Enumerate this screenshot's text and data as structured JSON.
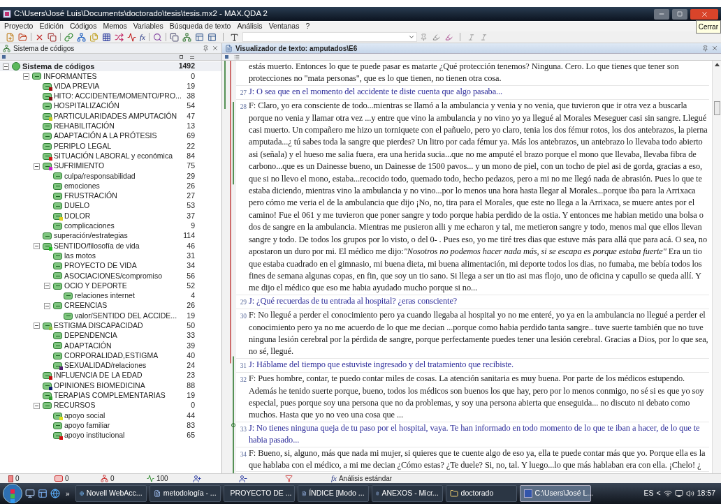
{
  "window": {
    "title": "C:\\Users\\José Luis\\Documents\\doctorado\\tesis\\tesis.mx2 - MAX.QDA 2",
    "tooltip": "Cerrar"
  },
  "menu": [
    "Proyecto",
    "Edición",
    "Códigos",
    "Memos",
    "Variables",
    "Búsqueda de texto",
    "Análisis",
    "Ventanas",
    "?"
  ],
  "toolbar": {
    "formula_symbol": "fx"
  },
  "code_system": {
    "title": "Sistema de códigos",
    "tree": [
      {
        "label": "Sistema de códigos",
        "count": "1492",
        "root": true,
        "expanded": true,
        "children": [
          {
            "label": "INFORMANTES",
            "count": "0",
            "expanded": true,
            "children": [
              {
                "label": "VIDA PREVIA",
                "count": "19",
                "color": "#a01010"
              },
              {
                "label": "HITO: ACCIDENTE/MOMENTO/PRO...",
                "count": "38",
                "color": "#801010"
              },
              {
                "label": "HOSPITALIZACIÓN",
                "count": "54"
              },
              {
                "label": "PARTICULARIDADES AMPUTACIÓN",
                "count": "47",
                "color": "#c8c820"
              },
              {
                "label": "REHABILITACIÓN",
                "count": "13"
              },
              {
                "label": "ADAPTACIÓN A LA PRÓTESIS",
                "count": "69"
              },
              {
                "label": "PERIPLO LEGAL",
                "count": "22"
              },
              {
                "label": "SITUACIÓN LABORAL y económica",
                "count": "84",
                "color": "#d01818"
              },
              {
                "label": "SUFRIMIENTO",
                "count": "75",
                "color": "#d020d0",
                "expanded": true,
                "children": [
                  {
                    "label": "culpa/responsabilidad",
                    "count": "29"
                  },
                  {
                    "label": "emociones",
                    "count": "26"
                  },
                  {
                    "label": "FRUSTRACIÓN",
                    "count": "27"
                  },
                  {
                    "label": "DUELO",
                    "count": "53"
                  },
                  {
                    "label": "DOLOR",
                    "count": "37",
                    "color": "#e0d020"
                  },
                  {
                    "label": "complicaciones",
                    "count": "9"
                  }
                ]
              },
              {
                "label": "superación/estrategias",
                "count": "114"
              },
              {
                "label": "SENTIDO/filosofía de vida",
                "count": "46",
                "color": "#20c020",
                "expanded": true,
                "children": [
                  {
                    "label": "las motos",
                    "count": "31"
                  },
                  {
                    "label": "PROYECTO DE VIDA",
                    "count": "34"
                  },
                  {
                    "label": "ASOCIACIONES/compromiso",
                    "count": "56"
                  },
                  {
                    "label": "OCIO Y DEPORTE",
                    "count": "52",
                    "expanded": true,
                    "children": [
                      {
                        "label": "relaciones internet",
                        "count": "4"
                      }
                    ]
                  },
                  {
                    "label": "CREENCIAS",
                    "count": "26",
                    "expanded": true,
                    "children": [
                      {
                        "label": "valor/SENTIDO DEL ACCIDE...",
                        "count": "19"
                      }
                    ]
                  }
                ]
              },
              {
                "label": "ESTIGMA DISCAPACIDAD",
                "count": "50",
                "color": "#90c040",
                "expanded": true,
                "children": [
                  {
                    "label": "DEPENDENCIA",
                    "count": "33"
                  },
                  {
                    "label": "ADAPTACIÓN",
                    "count": "39"
                  },
                  {
                    "label": "CORPORALIDAD,ESTIGMA",
                    "count": "40"
                  },
                  {
                    "label": "SEXUALIDAD/relaciones",
                    "count": "24",
                    "color": "#502070"
                  }
                ]
              },
              {
                "label": "INFLUENCIA DE LA EDAD",
                "count": "23",
                "color": "#c01010"
              },
              {
                "label": "OPINIONES BIOMEDICINA",
                "count": "88",
                "color": "#102070"
              },
              {
                "label": "TERAPIAS COMPLEMENTARIAS",
                "count": "19",
                "color": "#30a030"
              },
              {
                "label": "RECURSOS",
                "count": "0",
                "expanded": true,
                "children": [
                  {
                    "label": "apoyo social",
                    "count": "44",
                    "color": "#e0e020"
                  },
                  {
                    "label": "apoyo familiar",
                    "count": "83"
                  },
                  {
                    "label": "apoyo institucional",
                    "count": "65",
                    "color": "#d01010"
                  }
                ]
              }
            ]
          }
        ]
      }
    ]
  },
  "text_viewer": {
    "title": "Visualizador de texto: amputados\\E6",
    "paragraphs": [
      {
        "kind": "answer",
        "text": "estás muerto. Entonces lo que te puede pasar es matarte ¿Qué protección tenemos? Ninguna. Cero. Lo que tienes que tener son protecciones no \"mata personas\", que es lo que tienen, no tienen otra cosa."
      },
      {
        "kind": "question",
        "number": "27",
        "text": "J: O sea que en el momento del accidente te diste cuenta que algo pasaba..."
      },
      {
        "kind": "answer",
        "number": "28",
        "text": "F: Claro, yo era consciente de todo...mientras se llamó a la ambulancia y venia y no venia, que tuvieron que ir otra vez a buscarla porque no venia y llamar otra vez ...y entre que vino la ambulancia y no vino yo ya llegué al Morales Meseguer casi sin sangre. Llegué casi muerto. Un compañero me hizo un torniquete con el pañuelo, pero yo claro, tenia los dos fémur rotos, los dos antebrazos, la pierna amputada...¿ tú sabes toda la sangre que pierdes? Un litro por cada fémur ya. Más los antebrazos, un antebrazo lo llevaba todo abierto asi (señala) y el hueso me salia fuera, era una herida sucia...que no me amputé el brazo porque el mono que llevaba, llevaba fibra de carbono...que es un Dainesse bueno, un Dainesse de 1500 pavos... y un mono de piel, con un tocho de piel asi de gorda, gracias a eso, que si no llevo el mono, estaba...recocido todo, quemado todo, hecho pedazos, pero a mi no me llegó nada de abrasión. Pues lo que te estaba diciendo, mientras vino la ambulancia y no vino...por lo menos una hora hasta llegar al Morales...porque iba para la Arrixaca pero cómo me veria el de la ambulancia que dijo ¡No, no, tira para el Morales, que este no llega a la Arrixaca, se muere antes por el camino! Fue el 061 y me tuvieron que poner sangre y todo porque habia perdido de la ostia. Y entonces me habian metido una bolsa o dos de sangre en la ambulancia. Mientras me pusieron alli y me echaron y tal, me metieron sangre y todo, menos mal que ellos llevan sangre y todo. De todos los grupos por lo visto, o del  0- . Pues eso, yo me tiré tres dias que estuve más para allá que para acá. O sea, no apostaron un duro por mi. El médico me dijo:*\"Nosotros no podemos hacer nada más, si se escapa es porque estaba fuerte\"* Era un tio que estaba cuadrado en el gimnasio, mi buena dieta, mi buena alimentación,  mi deporte todos los dias, no fumaba, me bebía todos los fines de semana algunas copas, en fin, que soy un tio sano.  Si llega a ser un tio asi mas flojo, uno de oficina y capullo se queda allí. Y me dijo el médico que eso me habia ayudado mucho porque si no..."
      },
      {
        "kind": "question",
        "number": "29",
        "text": "J: ¿Qué recuerdas de tu entrada al hospital? ¿eras consciente?"
      },
      {
        "kind": "answer",
        "number": "30",
        "text": "F: No llegué a perder el conocimiento pero ya cuando llegaba al hospital yo no me enteré, yo ya en la ambulancia no llegué a perder el conocimiento pero ya no me acuerdo de lo que me decian ...porque como habia perdido tanta sangre.. tuve suerte también que no tuve ninguna lesión cerebral por la pérdida de sangre, porque perfectamente puedes tener una lesión cerebral. Gracias a Dios, por lo que sea, no sé, llegué."
      },
      {
        "kind": "question",
        "number": "31",
        "text": "J: Háblame del tiempo que estuviste ingresado y del tratamiento que recibiste."
      },
      {
        "kind": "answer",
        "number": "32",
        "text": "F: Pues hombre, contar, te puedo contar miles de cosas. La atención sanitaria es muy buena. Por parte de los médicos estupendo. Además he tenido suerte porque, bueno, todos los médicos son buenos los que hay, pero por lo menos conmigo, no sé si es que yo soy especial, pues porque soy una persona que  no da problemas, y soy una persona abierta que enseguida... no discuto ni debato como muchos. Hasta que yo no veo una cosa que ..."
      },
      {
        "kind": "question",
        "number": "33",
        "text": "J: No tienes ninguna queja de tu paso por el hospital, vaya. Te han informado en todo momento de lo que te iban a hacer, de lo que te habia pasado..."
      },
      {
        "kind": "answer",
        "number": "34",
        "text": "F: Bueno, si, alguno, más que nada mi mujer, si quieres que te cuente algo de eso ya, ella te puede contar más que yo. Porque ella es la que hablaba con el médico, a mi me decian ¿Cómo estas? ¿Te duele? Si, no, tal. Y luego...lo que más hablaban era con ella. ¡Chelo! ¿"
      }
    ]
  },
  "status_bar": [
    {
      "kind": "documents",
      "text": "0"
    },
    {
      "kind": "codes",
      "text": "0"
    },
    {
      "kind": "memos",
      "text": "0"
    },
    {
      "kind": "activation",
      "text": "100"
    },
    {
      "kind": "person-add"
    },
    {
      "kind": "person-remove"
    },
    {
      "kind": "filter"
    },
    {
      "kind": "formula",
      "symbol": "fx",
      "text": "Análisis estándar"
    }
  ],
  "taskbar": {
    "overflow": "»",
    "tasks": [
      {
        "label": "Novell WebAcc...",
        "kind": "browser",
        "selected": false
      },
      {
        "label": "metodología - ...",
        "kind": "document",
        "selected": false
      },
      {
        "label": "PROYECTO DE ...",
        "kind": "document",
        "selected": false
      },
      {
        "label": "ÍNDICE [Modo ...",
        "kind": "document",
        "selected": false
      },
      {
        "label": "ANEXOS - Micr...",
        "kind": "document",
        "selected": false
      },
      {
        "label": "doctorado",
        "kind": "folder",
        "selected": false
      },
      {
        "label": "C:\\Users\\José L...",
        "kind": "app",
        "selected": true
      }
    ],
    "language": "ES",
    "tray_expand": "<",
    "clock": "18:57"
  }
}
